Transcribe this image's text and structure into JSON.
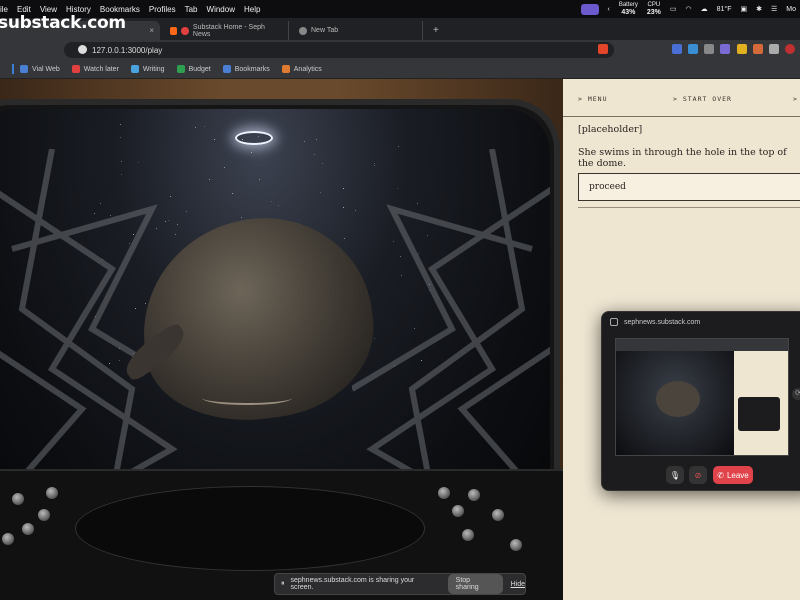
{
  "menubar": {
    "items": [
      "ile",
      "Edit",
      "View",
      "History",
      "Bookmarks",
      "Profiles",
      "Tab",
      "Window",
      "Help"
    ],
    "battery_label": "Battery",
    "battery_value": "43%",
    "cpu_label": "CPU",
    "cpu_value": "23%",
    "weather": "81°F",
    "user_abbrev": "Mo"
  },
  "overlay_title": "substack.com",
  "tabs": [
    {
      "label": "",
      "active": true
    },
    {
      "label": "Substack Home - Seph News",
      "active": false
    },
    {
      "label": "New Tab",
      "active": false
    }
  ],
  "tab_close": "×",
  "new_tab": "+",
  "address": {
    "url": "127.0.0.1:3000/play"
  },
  "bookmarks": [
    {
      "label": "Vial Web",
      "color": "#4a7fd4"
    },
    {
      "label": "Watch later",
      "color": "#e04040"
    },
    {
      "label": "Writing",
      "color": "#4aa3df"
    },
    {
      "label": "Budget",
      "color": "#2e9e4f"
    },
    {
      "label": "Bookmarks",
      "color": "#4a7fd4"
    },
    {
      "label": "Analytics",
      "color": "#e07a30"
    }
  ],
  "panel": {
    "nav_menu": "> MENU",
    "nav_start_over": "> START OVER",
    "nav_more": ">",
    "placeholder": "[placeholder]",
    "story": "She swims in through the hole in the top of the dome.",
    "proceed": "proceed"
  },
  "popup": {
    "site": "sephnews.substack.com",
    "leave": "Leave"
  },
  "sharebar": {
    "message": "sephnews.substack.com is sharing your screen.",
    "stop": "Stop sharing",
    "hide": "Hide"
  }
}
